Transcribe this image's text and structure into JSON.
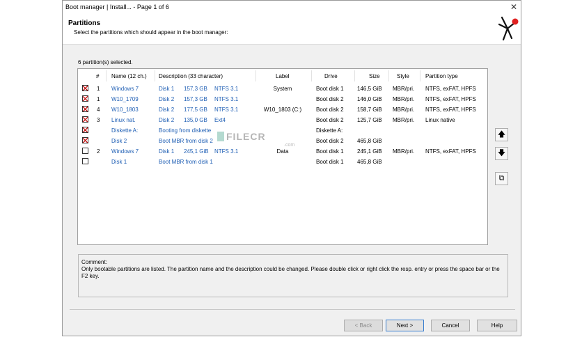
{
  "window": {
    "title": "Boot manager | Install...  -  Page 1 of 6",
    "close_glyph": "✕"
  },
  "header": {
    "title": "Partitions",
    "subtitle": "Select the partitions which should appear in the boot manager:"
  },
  "selection_count": "6 partition(s) selected.",
  "table": {
    "columns": [
      "#",
      "Name (12 ch.)",
      "Description (33 character)",
      "Label",
      "Drive",
      "Size",
      "Style",
      "Partition type"
    ],
    "rows": [
      {
        "checked": true,
        "num": "1",
        "name": "Windows 7",
        "desc_disk": "Disk 1",
        "desc_size": "157,3 GB",
        "desc_fs": "NTFS 3.1",
        "desc_full": "",
        "label": "System",
        "drive": "Boot disk 1",
        "size": "146,5 GiB",
        "style": "MBR/pri.",
        "ptype": "NTFS, exFAT, HPFS"
      },
      {
        "checked": true,
        "num": "1",
        "name": "W10_1709",
        "desc_disk": "Disk 2",
        "desc_size": "157,3 GB",
        "desc_fs": "NTFS 3.1",
        "desc_full": "",
        "label": "",
        "drive": "Boot disk 2",
        "size": "146,0 GiB",
        "style": "MBR/pri.",
        "ptype": "NTFS, exFAT, HPFS"
      },
      {
        "checked": true,
        "num": "4",
        "name": "W10_1803",
        "desc_disk": "Disk 2",
        "desc_size": "177,5 GB",
        "desc_fs": "NTFS 3.1",
        "desc_full": "",
        "label": "W10_1803 (C:)",
        "drive": "Boot disk 2",
        "size": "158,7 GiB",
        "style": "MBR/pri.",
        "ptype": "NTFS, exFAT, HPFS"
      },
      {
        "checked": true,
        "num": "3",
        "name": "Linux nat.",
        "desc_disk": "Disk 2",
        "desc_size": "135,0 GB",
        "desc_fs": "Ext4",
        "desc_full": "",
        "label": "",
        "drive": "Boot disk 2",
        "size": "125,7 GiB",
        "style": "MBR/pri.",
        "ptype": "Linux native"
      },
      {
        "checked": true,
        "num": "",
        "name": "Diskette A:",
        "desc_disk": "",
        "desc_size": "",
        "desc_fs": "",
        "desc_full": "Booting from diskette",
        "label": "",
        "drive": "Diskette A:",
        "size": "",
        "style": "",
        "ptype": ""
      },
      {
        "checked": true,
        "num": "",
        "name": "Disk 2",
        "desc_disk": "",
        "desc_size": "",
        "desc_fs": "",
        "desc_full": "Boot MBR from disk 2",
        "label": "",
        "drive": "Boot disk 2",
        "size": "465,8 GiB",
        "style": "",
        "ptype": ""
      },
      {
        "checked": false,
        "num": "2",
        "name": "Windows 7",
        "desc_disk": "Disk 1",
        "desc_size": "245,1 GiB",
        "desc_fs": "NTFS 3.1",
        "desc_full": "",
        "label": "Data",
        "drive": "Boot disk 1",
        "size": "245,1 GiB",
        "style": "MBR/pri.",
        "ptype": "NTFS, exFAT, HPFS"
      },
      {
        "checked": false,
        "num": "",
        "name": "Disk 1",
        "desc_disk": "",
        "desc_size": "",
        "desc_fs": "",
        "desc_full": "Boot MBR from disk 1",
        "label": "",
        "drive": "Boot disk 1",
        "size": "465,8 GiB",
        "style": "",
        "ptype": ""
      }
    ]
  },
  "side_buttons": {
    "up_glyph": "🡅",
    "down_glyph": "🡇",
    "copy_glyph": "⧉"
  },
  "comment": {
    "label": "Comment:",
    "text": "Only bootable partitions are listed. The partition name and the description could be changed. Please double click or right click the resp. entry or press the space bar or the F2 key."
  },
  "buttons": {
    "back": "< Back",
    "next": "Next >",
    "cancel": "Cancel",
    "help": "Help"
  },
  "watermark": {
    "text": "FILECR",
    "suffix": ".com"
  },
  "colors": {
    "link_blue": "#1e5eb4",
    "check_red": "#c81e1e",
    "logo_red": "#e02020"
  }
}
